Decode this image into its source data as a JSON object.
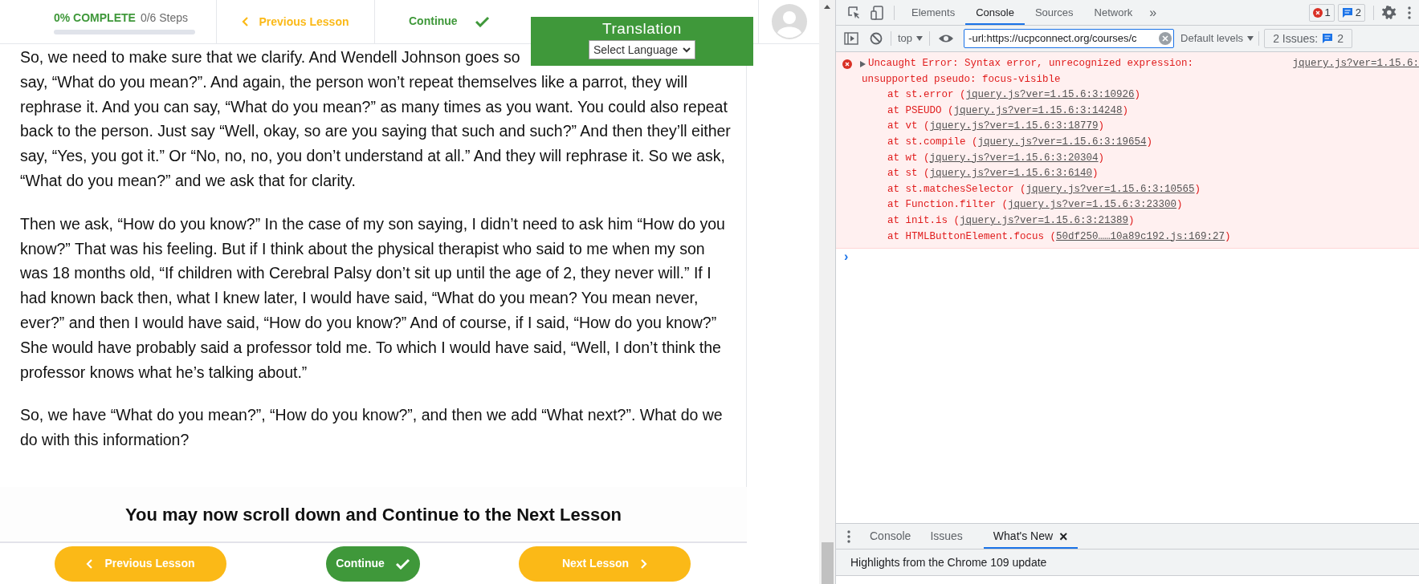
{
  "header": {
    "progress": {
      "label": "0% COMPLETE",
      "steps": "0/6 Steps",
      "level": 0
    },
    "previous": "Previous Lesson",
    "continue": "Continue"
  },
  "translation": {
    "title": "Translation",
    "select": "Select Language"
  },
  "article": {
    "clipped_line": "So, we need to make sure that we clarify. And Wendell Johnson goes so",
    "paragraphs": [
      "say, “What do you mean?”. And again, the person won’t repeat themselves like a parrot, they will rephrase it.  And you can say, “What do you mean?” as many times as you want. You could also repeat back to the person. Just say “Well, okay, so are you saying that such and such?” And then they’ll either say, “Yes, you got it.” Or “No, no, no, you don’t understand at all.” And they will rephrase it. So we ask, “What do you mean?” and we ask that for clarity.",
      "Then we ask, “How do you know?” In the case of my son saying, I didn’t need to ask him “How do you know?” That was his feeling. But if I think about the physical therapist who said to me when my son was 18 months old, “If children with Cerebral Palsy don’t sit up until the age of 2, they never will.” If I had known back then, what I knew later, I would have said, “What do you mean? You mean never, ever?” and then I would have said, “How do you know?” And of course, if I said, “How do you know?” She would have probably said a professor told me. To which I would have said, “Well, I don’t think the professor knows what he’s talking about.”",
      "So, we have “What do you mean?”, “How do you know?”, and then we add “What next?”. What do we do with this information?"
    ]
  },
  "banner": "You may now scroll down and Continue to the Next Lesson",
  "footer_buttons": [
    {
      "kind": "previous",
      "label": "Previous Lesson"
    },
    {
      "kind": "continue",
      "label": "Continue"
    },
    {
      "kind": "next",
      "label": "Next Lesson"
    }
  ],
  "devtools": {
    "tabs": [
      {
        "label": "Elements",
        "selected": false
      },
      {
        "label": "Console",
        "selected": true
      },
      {
        "label": "Sources",
        "selected": false
      },
      {
        "label": "Network",
        "selected": false
      }
    ],
    "more": "»",
    "error_count": "1",
    "message_count": "2",
    "context": "top",
    "filter": "-url:https://ucpconnect.org/courses/c",
    "levels": "Default levels",
    "issues": "2 Issues:",
    "issues_count": "2",
    "error": {
      "message_lines": [
        "Uncaught Error: Syntax error, unrecognized expression:",
        "unsupported pseudo: focus-visible"
      ],
      "source": "jquery.js?ver=1.15.6:",
      "stack": [
        {
          "before": "at st.error (",
          "link": "jquery.js?ver=1.15.6:3:10926",
          "after": ")"
        },
        {
          "before": "at PSEUDO (",
          "link": "jquery.js?ver=1.15.6:3:14248",
          "after": ")"
        },
        {
          "before": "at vt (",
          "link": "jquery.js?ver=1.15.6:3:18779",
          "after": ")"
        },
        {
          "before": "at st.compile (",
          "link": "jquery.js?ver=1.15.6:3:19654",
          "after": ")"
        },
        {
          "before": "at wt (",
          "link": "jquery.js?ver=1.15.6:3:20304",
          "after": ")"
        },
        {
          "before": "at st (",
          "link": "jquery.js?ver=1.15.6:3:6140",
          "after": ")"
        },
        {
          "before": "at st.matchesSelector (",
          "link": "jquery.js?ver=1.15.6:3:10565",
          "after": ")"
        },
        {
          "before": "at Function.filter (",
          "link": "jquery.js?ver=1.15.6:3:23300",
          "after": ")"
        },
        {
          "before": "at init.is (",
          "link": "jquery.js?ver=1.15.6:3:21389",
          "after": ")"
        },
        {
          "before": "at HTMLButtonElement.focus (",
          "link": "50df250……10a89c192.js:169:27",
          "after": ")"
        }
      ]
    },
    "prompt": "›",
    "drawer": {
      "tabs": [
        {
          "label": "Console",
          "selected": false,
          "closable": false
        },
        {
          "label": "Issues",
          "selected": false,
          "closable": false
        },
        {
          "label": "What's New",
          "selected": true,
          "closable": true
        }
      ],
      "close": "×",
      "content": "Highlights from the Chrome 109 update"
    }
  }
}
